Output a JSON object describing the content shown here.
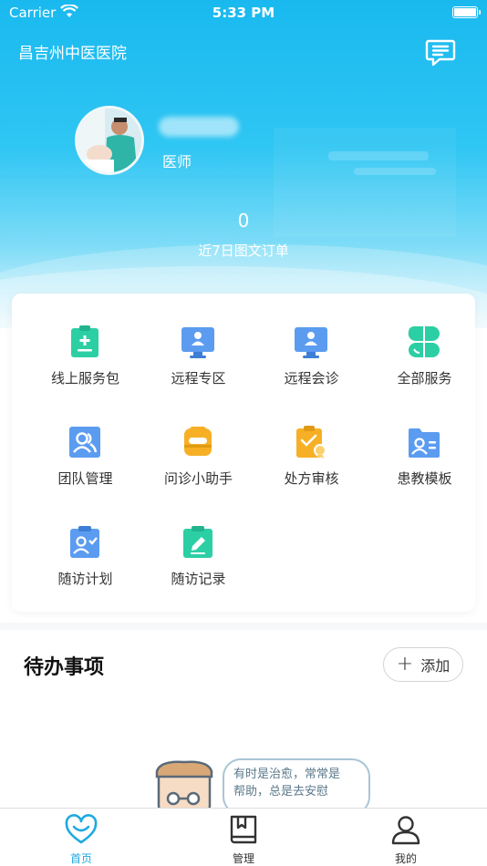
{
  "status_bar": {
    "carrier": "Carrier",
    "time": "5:33 PM"
  },
  "header": {
    "hospital_name": "昌吉州中医医院",
    "message_icon": "message-icon"
  },
  "profile": {
    "role": "医师",
    "order_count": "0",
    "order_label": "近7日图文订单"
  },
  "services": [
    {
      "label": "线上服务包",
      "icon": "service-package-icon"
    },
    {
      "label": "远程专区",
      "icon": "remote-zone-icon"
    },
    {
      "label": "远程会诊",
      "icon": "remote-consultation-icon"
    },
    {
      "label": "全部服务",
      "icon": "all-services-icon"
    },
    {
      "label": "团队管理",
      "icon": "team-management-icon"
    },
    {
      "label": "问诊小助手",
      "icon": "consultation-assistant-icon"
    },
    {
      "label": "处方审核",
      "icon": "prescription-review-icon"
    },
    {
      "label": "患教模板",
      "icon": "patient-education-template-icon"
    },
    {
      "label": "随访计划",
      "icon": "follow-up-plan-icon"
    },
    {
      "label": "随访记录",
      "icon": "follow-up-record-icon"
    }
  ],
  "todo": {
    "title": "待办事项",
    "add_label": "添加"
  },
  "empty_state": {
    "line1": "有时是治愈，常常是",
    "line2": "帮助，总是去安慰"
  },
  "tab_bar": {
    "items": [
      {
        "label": "首页",
        "icon": "heart-icon",
        "active": true
      },
      {
        "label": "管理",
        "icon": "book-icon",
        "active": false
      },
      {
        "label": "我的",
        "icon": "user-icon",
        "active": false
      }
    ]
  },
  "colors": {
    "accent": "#1fa9e0",
    "hero_top": "#19b9ef",
    "green": "#2ccfa4",
    "blue": "#5b9cf0",
    "orange": "#f7b025"
  }
}
